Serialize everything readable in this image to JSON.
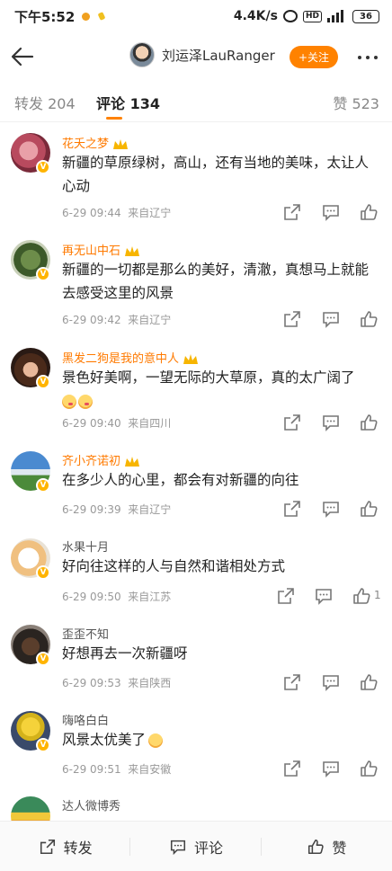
{
  "status": {
    "time": "下午5:52",
    "speed": "4.4K/s",
    "battery": "36"
  },
  "header": {
    "username": "刘运泽LauRanger",
    "follow_label": "+关注"
  },
  "tabs": {
    "repost": "转发 204",
    "comment": "评论 134",
    "like": "赞 523"
  },
  "comments": [
    {
      "name": "花夭之梦",
      "text": "新疆的草原绿树，高山，还有当地的美味，太让人心动",
      "time": "6-29 09:44",
      "location": "来自辽宁",
      "likes": ""
    },
    {
      "name": "再无山中石",
      "text": "新疆的一切都是那么的美好，清澈，真想马上就能去感受这里的风景",
      "time": "6-29 09:42",
      "location": "来自辽宁",
      "likes": ""
    },
    {
      "name": "黑发二狗是我的意中人",
      "text": "景色好美啊，一望无际的大草原，真的太广阔了",
      "time": "6-29 09:40",
      "location": "来自四川",
      "likes": ""
    },
    {
      "name": "齐小齐诺初",
      "text": "在多少人的心里，都会有对新疆的向往",
      "time": "6-29 09:39",
      "location": "来自辽宁",
      "likes": ""
    },
    {
      "name": "水果十月",
      "text": "好向往这样的人与自然和谐相处方式",
      "time": "6-29 09:50",
      "location": "来自江苏",
      "likes": "1"
    },
    {
      "name": "歪歪不知",
      "text": "好想再去一次新疆呀",
      "time": "6-29 09:53",
      "location": "来自陕西",
      "likes": ""
    },
    {
      "name": "嗨咯白白",
      "text": "风景太优美了",
      "time": "6-29 09:51",
      "location": "来自安徽",
      "likes": ""
    },
    {
      "name": "达人微博秀",
      "text": "",
      "time": "",
      "location": "",
      "likes": ""
    }
  ],
  "bottom": {
    "repost": "转发",
    "comment": "评论",
    "like": "赞"
  },
  "colors": {
    "accent": "#ff8200",
    "vip_name": "#ff7a00"
  }
}
